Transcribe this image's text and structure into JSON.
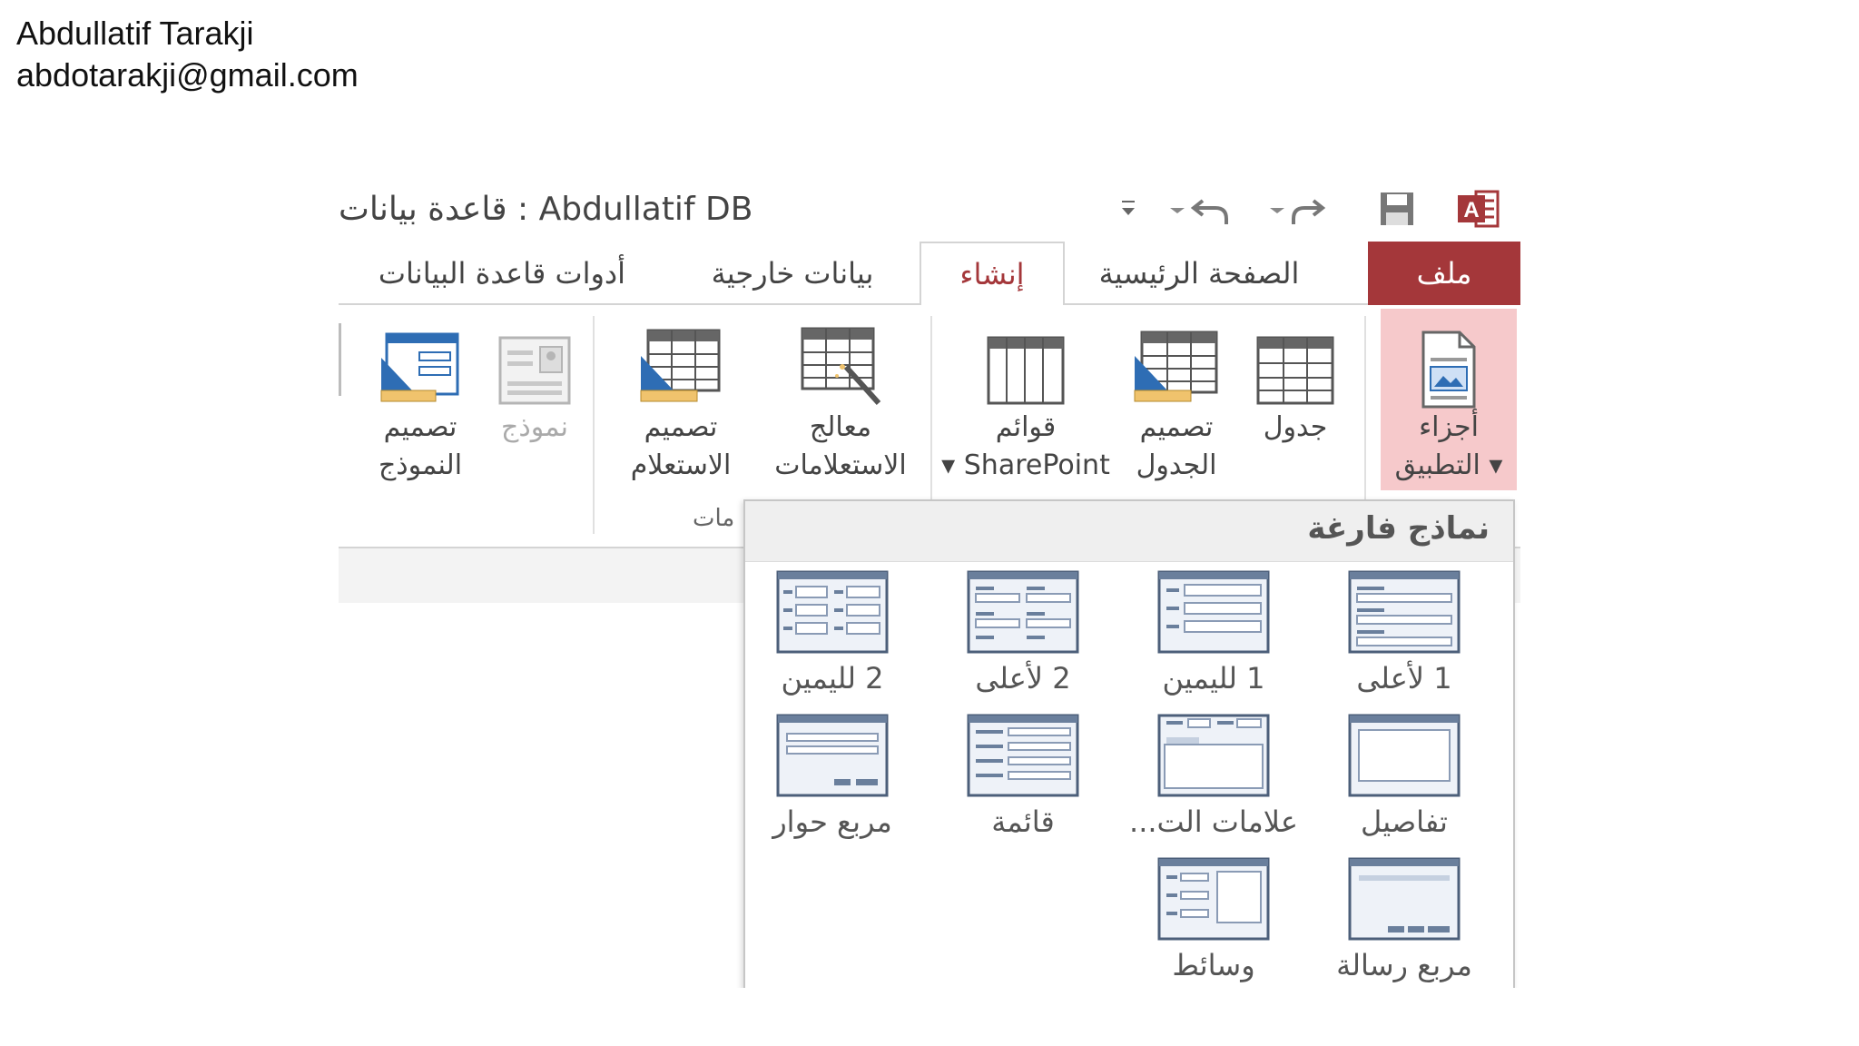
{
  "author": {
    "name": "Abdullatif Tarakji",
    "email": "abdotarakji@gmail.com"
  },
  "window": {
    "title": "Abdullatif DB : قاعدة بيانات"
  },
  "quick_access": [
    "access-logo-icon",
    "save-icon",
    "redo-icon",
    "undo-icon",
    "customize-icon"
  ],
  "tabs": [
    {
      "label": "ملف"
    },
    {
      "label": "الصفحة الرئيسية"
    },
    {
      "label": "إنشاء"
    },
    {
      "label": "بيانات خارجية"
    },
    {
      "label": "أدوات قاعدة البيانات"
    }
  ],
  "ribbon": {
    "app_parts": {
      "line1": "أجزاء",
      "line2": "التطبيق ▾"
    },
    "table": {
      "line1": "جدول",
      "line2": ""
    },
    "table_design": {
      "line1": "تصميم",
      "line2": "الجدول"
    },
    "sharepoint_lists": {
      "line1": "قوائم",
      "line2": "▾ SharePoint"
    },
    "query_wizard": {
      "line1": "معالج",
      "line2": "الاستعلامات"
    },
    "query_design": {
      "line1": "تصميم",
      "line2": "الاستعلام"
    },
    "form": {
      "line1": "نموذج",
      "line2": ""
    },
    "form_design": {
      "line1": "تصميم",
      "line2": "النموذج"
    },
    "queries_group_label": "مات"
  },
  "dropdown": {
    "header": "نماذج فارغة",
    "templates": [
      {
        "label": "1 لأعلى",
        "icon": "1-top-icon"
      },
      {
        "label": "1 لليمين",
        "icon": "1-right-icon"
      },
      {
        "label": "2 لأعلى",
        "icon": "2-top-icon"
      },
      {
        "label": "2 لليمين",
        "icon": "2-right-icon"
      },
      {
        "label": "تفاصيل",
        "icon": "details-icon"
      },
      {
        "label": "علامات الت...",
        "icon": "tabs-icon"
      },
      {
        "label": "قائمة",
        "icon": "list-icon"
      },
      {
        "label": "مربع حوار",
        "icon": "dialog-icon"
      },
      {
        "label": "مربع رسالة",
        "icon": "message-box-icon"
      },
      {
        "label": "وسائط",
        "icon": "media-icon"
      }
    ]
  },
  "colors": {
    "file_tab": "#a4373a",
    "highlight": "#f6c9cb",
    "accent_blue": "#2e6db4"
  }
}
